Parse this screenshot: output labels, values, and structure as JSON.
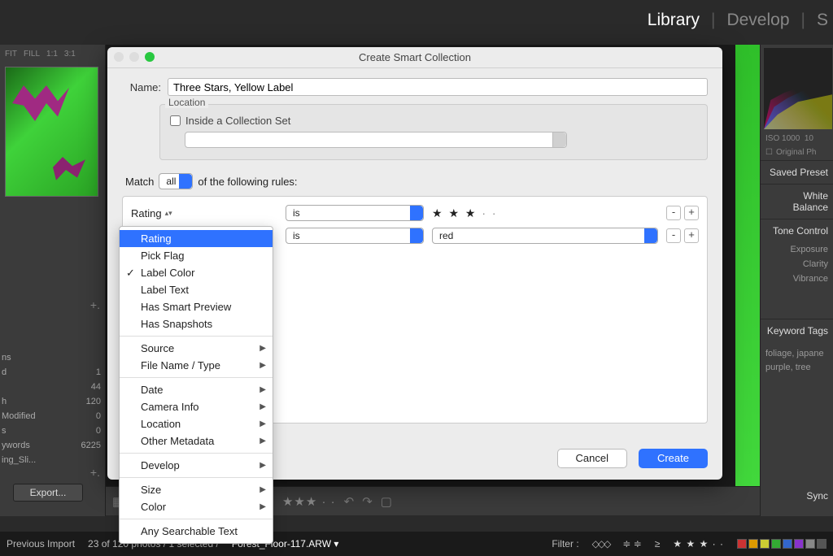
{
  "topnav": {
    "library": "Library",
    "develop": "Develop",
    "next": "S"
  },
  "viewctrl": {
    "fit": "FIT",
    "fill": "FILL",
    "z1": "1:1",
    "z2": "3:1"
  },
  "catalog": {
    "items": [
      {
        "lbl": "ns",
        "count": ""
      },
      {
        "lbl": "d",
        "count": "1"
      },
      {
        "lbl": "",
        "count": "44"
      },
      {
        "lbl": "h",
        "count": "120"
      },
      {
        "lbl": "Modified",
        "count": "0"
      },
      {
        "lbl": "s",
        "count": "0"
      },
      {
        "lbl": "ywords",
        "count": "6225"
      },
      {
        "lbl": "ing_Sli...",
        "count": ""
      }
    ]
  },
  "export_label": "Export...",
  "histo": {
    "iso": "ISO 1000",
    "mm": "10",
    "orig": "Original Ph"
  },
  "rpanels": {
    "saved": "Saved Preset",
    "wb": "White Balance",
    "tone": "Tone Control",
    "exposure": "Exposure",
    "clarity": "Clarity",
    "vibrance": "Vibrance",
    "kw_head": "Keyword Tags",
    "kw_body": "foliage, japane\npurple, tree"
  },
  "sync": "Sync",
  "footer": {
    "prev": "Previous Import",
    "count": "23 of 120 photos / 1 selected /",
    "file": "Forest_Floor-117.ARW",
    "filter": "Filter :",
    "ge": "≥"
  },
  "dlg": {
    "title": "Create Smart Collection",
    "name_label": "Name:",
    "name_value": "Three Stars, Yellow Label",
    "location": "Location",
    "inside": "Inside a Collection Set",
    "match_pre": "Match",
    "match_val": "all",
    "match_post": "of the following rules:",
    "rule1": {
      "crit": "Rating",
      "op": "is",
      "stars": "★ ★ ★",
      "dots": "· ·"
    },
    "rule2": {
      "op": "is",
      "val": "red"
    },
    "cancel": "Cancel",
    "create": "Create",
    "minus": "-",
    "plus": "+"
  },
  "menu": {
    "g1": [
      "Rating",
      "Pick Flag",
      "Label Color",
      "Label Text",
      "Has Smart Preview",
      "Has Snapshots"
    ],
    "highlighted": "Rating",
    "checked": "Label Color",
    "g2": [
      "Source",
      "File Name / Type"
    ],
    "g3": [
      "Date",
      "Camera Info",
      "Location",
      "Other Metadata"
    ],
    "g4": [
      "Develop"
    ],
    "g5": [
      "Size",
      "Color"
    ],
    "g6": [
      "Any Searchable Text"
    ]
  },
  "colors": {
    "chips": [
      "#c33",
      "#d90",
      "#cc3",
      "#3a3",
      "#36c",
      "#83c",
      "#888",
      "#555"
    ]
  }
}
